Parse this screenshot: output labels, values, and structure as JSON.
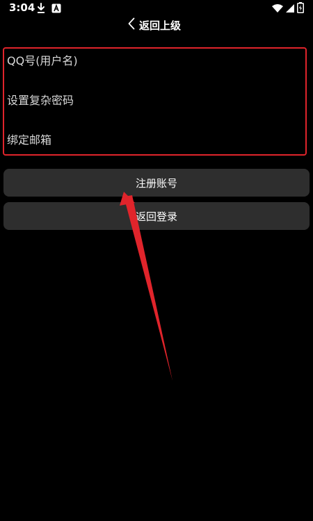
{
  "status_bar": {
    "time": "3:04",
    "icons": [
      "download-icon",
      "app-a-icon",
      "wifi-icon",
      "signal-icon",
      "battery-icon"
    ]
  },
  "header": {
    "back_label": "返回上级",
    "back_icon": "chevron-left-icon"
  },
  "form": {
    "username_placeholder": "QQ号(用户名)",
    "password_placeholder": "设置复杂密码",
    "email_placeholder": "绑定邮箱",
    "highlight_color": "#e0242b"
  },
  "buttons": {
    "register_label": "注册账号",
    "back_to_login_label": "返回登录"
  },
  "colors": {
    "background": "#000000",
    "button_bg": "#2e2e2e",
    "annotation": "#e0242b",
    "text": "#ffffff"
  }
}
